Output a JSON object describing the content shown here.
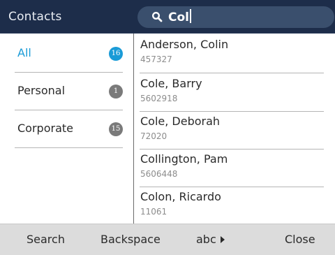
{
  "header": {
    "title": "Contacts",
    "search_value": "Col"
  },
  "categories": [
    {
      "label": "All",
      "count": "16",
      "active": true
    },
    {
      "label": "Personal",
      "count": "1",
      "active": false
    },
    {
      "label": "Corporate",
      "count": "15",
      "active": false
    }
  ],
  "contacts": [
    {
      "name": "Anderson, Colin",
      "number": "457327"
    },
    {
      "name": "Cole, Barry",
      "number": "5602918"
    },
    {
      "name": "Cole, Deborah",
      "number": "72020"
    },
    {
      "name": "Collington, Pam",
      "number": "5606448"
    },
    {
      "name": "Colon, Ricardo",
      "number": "11061"
    }
  ],
  "softkeys": {
    "search": "Search",
    "backspace": "Backspace",
    "abc": "abc",
    "close": "Close"
  },
  "colors": {
    "titlebar": "#1d2d4a",
    "searchbox": "#3a4f6d",
    "accent": "#1a9bd7",
    "badge_inactive": "#7a7a7a",
    "softbar": "#dcdcdc"
  },
  "icons": {
    "search": "search-icon",
    "abc_arrow": "triangle-right-icon"
  }
}
